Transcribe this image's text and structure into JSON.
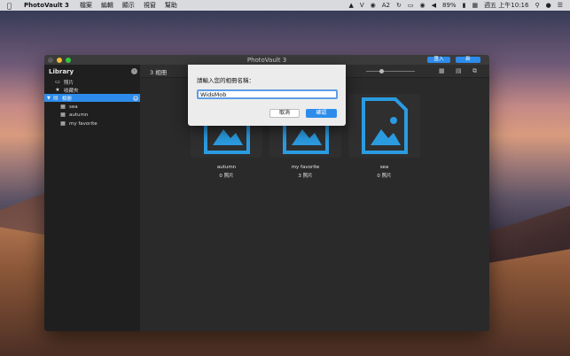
{
  "menubar": {
    "app_name": "PhotoVault 3",
    "menus": [
      "檔案",
      "編輯",
      "顯示",
      "視窗",
      "幫助"
    ],
    "battery": "89%",
    "clock": "週五 上午10:16",
    "status_icons": [
      "dropbox-icon",
      "v-icon",
      "lock-icon",
      "adobe-icon",
      "time-machine-icon",
      "display-icon",
      "wifi-icon",
      "volume-icon",
      "battery-icon",
      "input-source-icon",
      "search-icon",
      "siri-icon",
      "notification-icon"
    ]
  },
  "window": {
    "title": "PhotoVault 3",
    "import_label": "匯入",
    "new_label": "新"
  },
  "sidebar": {
    "library_label": "Library",
    "items": [
      {
        "label": "照片",
        "icon": "photo-icon"
      },
      {
        "label": "收藏夾",
        "icon": "star-icon"
      },
      {
        "label": "相冊",
        "icon": "album-icon"
      },
      {
        "label": "sea",
        "icon": "image-icon"
      },
      {
        "label": "autumn",
        "icon": "image-icon"
      },
      {
        "label": "my favorite",
        "icon": "image-icon"
      }
    ]
  },
  "main": {
    "count_label": "3 相冊",
    "albums": [
      {
        "name": "autumn",
        "count": "0 照片"
      },
      {
        "name": "my favorite",
        "count": "3 照片"
      },
      {
        "name": "sea",
        "count": "0 照片"
      }
    ]
  },
  "dialog": {
    "prompt": "請輸入您的相冊名稱：",
    "input_value": "WidsMob",
    "cancel_label": "取消",
    "ok_label": "確認"
  },
  "colors": {
    "accent": "#2d8ceb",
    "album_icon": "#2b9be0"
  }
}
